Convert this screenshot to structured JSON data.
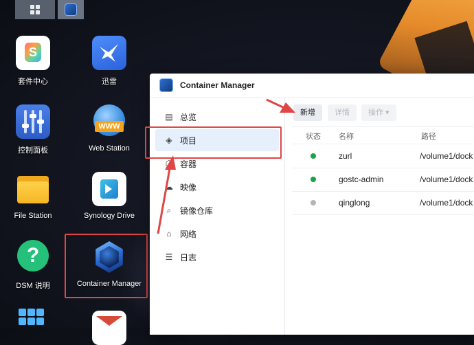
{
  "colors": {
    "highlight": "#e04646",
    "running": "#1aa34a",
    "stopped": "#b5b5b5",
    "selected_bg": "#e6effc"
  },
  "taskbar": {
    "main_menu_icon": "grid-icon",
    "active_app_icon": "container-manager-icon"
  },
  "desktop_icons": [
    {
      "label": "套件中心",
      "icon": "package-center-icon"
    },
    {
      "label": "迅雷",
      "icon": "thunder-icon"
    },
    {
      "label": "控制面板",
      "icon": "control-panel-icon"
    },
    {
      "label": "Web Station",
      "icon": "web-station-icon"
    },
    {
      "label": "File Station",
      "icon": "file-station-icon"
    },
    {
      "label": "Synology Drive",
      "icon": "synology-drive-icon"
    },
    {
      "label": "DSM 说明",
      "icon": "help-icon"
    },
    {
      "label": "Container Manager",
      "icon": "container-manager-icon"
    }
  ],
  "window": {
    "title": "Container Manager",
    "nav": [
      {
        "label": "总览",
        "icon": "overview-icon"
      },
      {
        "label": "项目",
        "icon": "layers-icon",
        "selected": true
      },
      {
        "label": "容器",
        "icon": "container-icon"
      },
      {
        "label": "映像",
        "icon": "cloud-icon"
      },
      {
        "label": "镜像仓库",
        "icon": "registry-search-icon"
      },
      {
        "label": "网络",
        "icon": "network-icon"
      },
      {
        "label": "日志",
        "icon": "log-icon"
      }
    ],
    "toolbar": {
      "add": "新增",
      "details": "详情",
      "action": "操作 ▾"
    },
    "table": {
      "headers": {
        "status": "状态",
        "name": "名称",
        "path": "路径"
      },
      "rows": [
        {
          "status": "running",
          "name": "zurl",
          "path": "/volume1/dock"
        },
        {
          "status": "running",
          "name": "gostc-admin",
          "path": "/volume1/dock"
        },
        {
          "status": "stopped",
          "name": "qinglong",
          "path": "/volume1/dock"
        }
      ]
    }
  }
}
